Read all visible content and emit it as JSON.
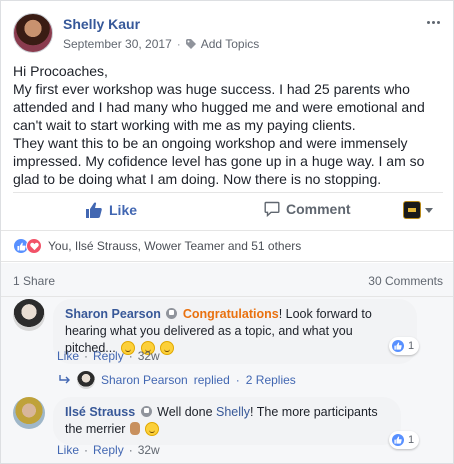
{
  "post": {
    "author": "Shelly Kaur",
    "date": "September 30, 2017",
    "separator": "·",
    "add_topics": "Add Topics",
    "body": [
      "Hi Procoaches,",
      "My first ever workshop was huge success. I had 25 parents who attended and I had many who hugged me and were emotional and can't wait to start working with me as my paying clients.",
      "They want this to be an ongoing workshop and were immensely impressed. My cofidence level has gone up in a huge way. I am so glad to be doing what I am doing. Now there is no stopping."
    ]
  },
  "actions": {
    "like": "Like",
    "comment": "Comment"
  },
  "reactions": {
    "summary": "You, Ilsé Strauss, Wower Teamer and 51 others"
  },
  "stats": {
    "shares": "1 Share",
    "comments": "30 Comments"
  },
  "comments": [
    {
      "name": "Sharon Pearson",
      "highlight": "Congratulations",
      "text": "! Look forward to hearing what you delivered as a topic, and what you pitched...",
      "like_count": "1",
      "like": "Like",
      "reply": "Reply",
      "sep": "·",
      "time": "32w"
    },
    {
      "name": "Ilsé Strauss",
      "text_before": "Well done ",
      "mention": "Shelly",
      "text_after": "! The more participants the merrier",
      "like_count": "1",
      "like": "Like",
      "reply": "Reply",
      "sep": "·",
      "time": "32w"
    }
  ],
  "replies": {
    "name": "Sharon Pearson",
    "text": "replied",
    "sep": "·",
    "count": "2 Replies"
  },
  "colors": {
    "link": "#365899",
    "like_blue": "#4267b2",
    "congrats_orange": "#e9710f"
  }
}
